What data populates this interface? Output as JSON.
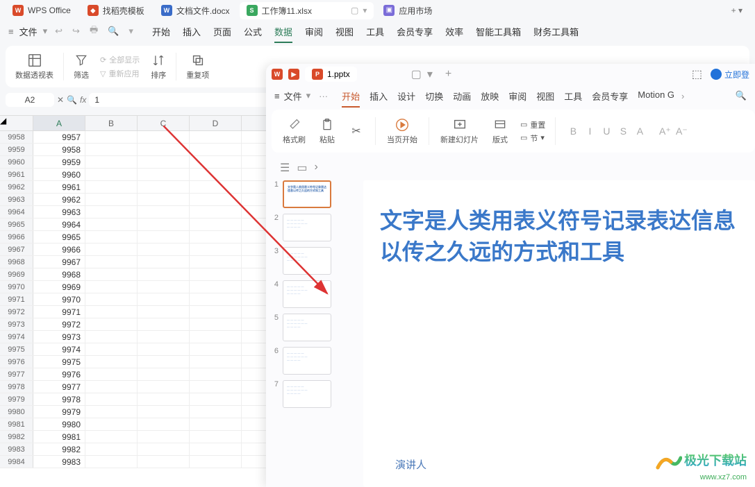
{
  "topTabs": {
    "items": [
      {
        "icon": "W",
        "cls": "orange",
        "label": "WPS Office"
      },
      {
        "icon": "◆",
        "cls": "orange",
        "label": "找稻壳模板"
      },
      {
        "icon": "W",
        "cls": "blue",
        "label": "文档文件.docx"
      },
      {
        "icon": "S",
        "cls": "green",
        "label": "工作簿11.xlsx",
        "active": true,
        "winctrl": true
      },
      {
        "icon": "▣",
        "cls": "purple",
        "label": "应用市场"
      }
    ],
    "new": "+"
  },
  "menu": {
    "left": [
      "≡",
      "文件",
      "▾"
    ],
    "icons": [
      "↩",
      "↪",
      "🖶",
      "🔍",
      "▾"
    ],
    "items": [
      "开始",
      "插入",
      "页面",
      "公式",
      "数据",
      "审阅",
      "视图",
      "工具",
      "会员专享",
      "效率",
      "智能工具箱",
      "财务工具箱"
    ],
    "active": "数据"
  },
  "toolbar": {
    "pivot": "数据透视表",
    "filter": "筛选",
    "showAll": "全部显示",
    "reapply": "重新应用",
    "sort": "排序",
    "dup": "重复项"
  },
  "fbar": {
    "cell": "A2",
    "formula": "1"
  },
  "sheet": {
    "cols": [
      "A",
      "B",
      "C",
      "D"
    ],
    "selCol": "A",
    "startRow": 9958,
    "rowCount": 27,
    "startVal": 9957
  },
  "ppt": {
    "tab": {
      "icon": "P",
      "label": "1.pptx"
    },
    "menuLeft": [
      "≡",
      "文件",
      "▾"
    ],
    "menuDots": "···",
    "menuItems": [
      "开始",
      "插入",
      "设计",
      "切换",
      "动画",
      "放映",
      "审阅",
      "视图",
      "工具",
      "会员专享",
      "Motion G"
    ],
    "menuActive": "开始",
    "login": "立即登",
    "tb": {
      "brush": "格式刷",
      "paste": "粘贴",
      "cut": "✂",
      "play": "当页开始",
      "new": "新建幻灯片",
      "layout": "版式",
      "section": "节",
      "reset": "重置"
    },
    "fonts": [
      "B",
      "I",
      "U",
      "S",
      "A"
    ],
    "thumbs": [
      1,
      2,
      3,
      4,
      5,
      6,
      7
    ],
    "slideTitle": "文字是人类用表义符号记录表达信息以传之久远的方式和工具",
    "presenter": "演讲人"
  },
  "watermark": {
    "name": "极光下载站",
    "url": "www.xz7.com"
  }
}
